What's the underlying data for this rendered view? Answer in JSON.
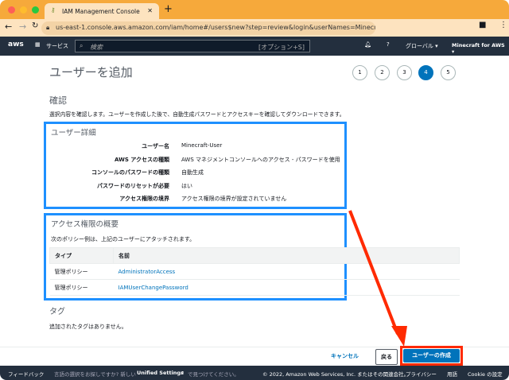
{
  "browser": {
    "tab_title": "IAM Management Console",
    "url": "us-east-1.console.aws.amazon.com/iam/home#/users$new?step=review&login&userNames=Minecraft-User..."
  },
  "nav": {
    "logo": "aws",
    "services": "サービス",
    "search_placeholder": "検索",
    "search_hint": "[オプション+S]",
    "region": "グローバル ▾",
    "account": "Minecraft for AWS ▾"
  },
  "page": {
    "title": "ユーザーを追加",
    "steps": [
      "1",
      "2",
      "3",
      "4",
      "5"
    ],
    "active_step": 4,
    "section": "確認",
    "description": "選択内容を確認します。ユーザーを作成した後で、自動生成パスワードとアクセスキーを確認してダウンロードできます。",
    "details": {
      "title": "ユーザー詳細",
      "rows": [
        {
          "label": "ユーザー名",
          "value": "Minecraft-User"
        },
        {
          "label": "AWS アクセスの種類",
          "value": "AWS マネジメントコンソールへのアクセス - パスワードを使用"
        },
        {
          "label": "コンソールのパスワードの種類",
          "value": "自動生成"
        },
        {
          "label": "パスワードのリセットが必要",
          "value": "はい"
        },
        {
          "label": "アクセス権限の境界",
          "value": "アクセス権限の境界が設定されていません"
        }
      ]
    },
    "permissions": {
      "title": "アクセス権限の概要",
      "description": "次のポリシー例は、上記のユーザーにアタッチされます。",
      "headers": [
        "タイプ",
        "名前"
      ],
      "rows": [
        {
          "type": "管理ポリシー",
          "name": "AdministratorAccess"
        },
        {
          "type": "管理ポリシー",
          "name": "IAMUserChangePassword"
        }
      ]
    },
    "tags": {
      "title": "タグ",
      "empty": "追加されたタグはありません。"
    }
  },
  "actions": {
    "cancel": "キャンセル",
    "back": "戻る",
    "create": "ユーザーの作成"
  },
  "footer": {
    "feedback": "フィードバック",
    "language": "言語の選択をお探しですか? 新しい",
    "unified": "Unified Settings",
    "language_end": "で見つけてください。",
    "copyright": "© 2022, Amazon Web Services, Inc. またはその関連会社。",
    "privacy": "プライバシー",
    "terms": "用語",
    "cookie": "Cookie の設定"
  },
  "colors": {
    "accent": "#0073bb",
    "highlight": "#1e90ff",
    "arrow": "#ff2a00"
  }
}
